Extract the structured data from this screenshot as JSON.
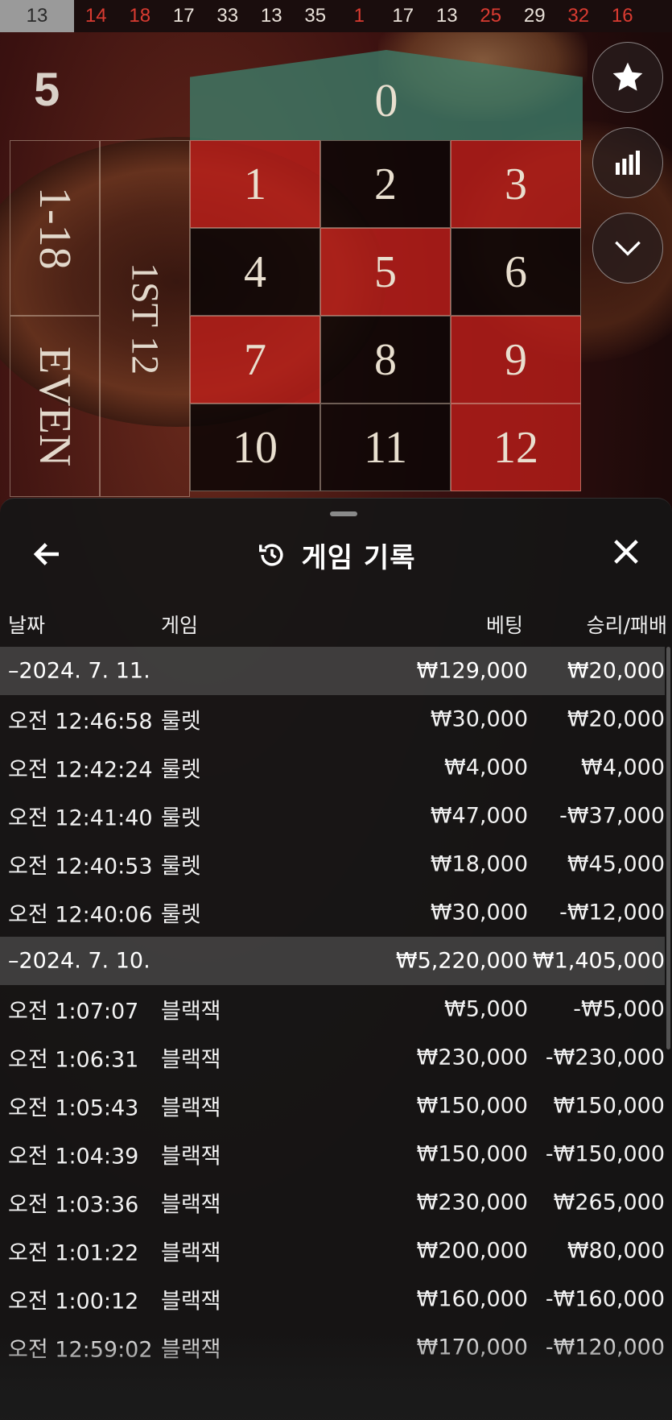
{
  "history_strip": [
    {
      "n": "13",
      "color": "gray"
    },
    {
      "n": "14",
      "color": "red"
    },
    {
      "n": "18",
      "color": "red"
    },
    {
      "n": "17",
      "color": "black"
    },
    {
      "n": "33",
      "color": "black"
    },
    {
      "n": "13",
      "color": "black"
    },
    {
      "n": "35",
      "color": "black"
    },
    {
      "n": "1",
      "color": "red"
    },
    {
      "n": "17",
      "color": "black"
    },
    {
      "n": "13",
      "color": "black"
    },
    {
      "n": "25",
      "color": "red"
    },
    {
      "n": "29",
      "color": "black"
    },
    {
      "n": "32",
      "color": "red"
    },
    {
      "n": "16",
      "color": "red"
    }
  ],
  "last_result": "5",
  "table": {
    "zero": "0",
    "side_low": "1-18",
    "side_even": "EVEN",
    "dozen_first": "1ST 12",
    "numbers": [
      {
        "n": "1",
        "c": "r"
      },
      {
        "n": "2",
        "c": "b"
      },
      {
        "n": "3",
        "c": "r"
      },
      {
        "n": "4",
        "c": "b"
      },
      {
        "n": "5",
        "c": "r"
      },
      {
        "n": "6",
        "c": "b"
      },
      {
        "n": "7",
        "c": "r"
      },
      {
        "n": "8",
        "c": "b"
      },
      {
        "n": "9",
        "c": "r"
      },
      {
        "n": "10",
        "c": "b"
      },
      {
        "n": "11",
        "c": "b"
      },
      {
        "n": "12",
        "c": "r"
      }
    ]
  },
  "side_buttons": [
    "star-icon",
    "stats-icon",
    "chevron-down-icon"
  ],
  "sheet": {
    "title": "게임 기록",
    "columns": {
      "date": "날짜",
      "game": "게임",
      "bet": "베팅",
      "win_loss": "승리/패배"
    },
    "sections": [
      {
        "date": "–2024. 7. 11.",
        "bet_total": "₩129,000",
        "win_total": "₩20,000",
        "rows": [
          {
            "time": "오전 12:46:58",
            "game": "룰렛",
            "bet": "₩30,000",
            "win": "₩20,000"
          },
          {
            "time": "오전 12:42:24",
            "game": "룰렛",
            "bet": "₩4,000",
            "win": "₩4,000"
          },
          {
            "time": "오전 12:41:40",
            "game": "룰렛",
            "bet": "₩47,000",
            "win": "-₩37,000"
          },
          {
            "time": "오전 12:40:53",
            "game": "룰렛",
            "bet": "₩18,000",
            "win": "₩45,000"
          },
          {
            "time": "오전 12:40:06",
            "game": "룰렛",
            "bet": "₩30,000",
            "win": "-₩12,000"
          }
        ]
      },
      {
        "date": "–2024. 7. 10.",
        "bet_total": "₩5,220,000",
        "win_total": "₩1,405,000",
        "rows": [
          {
            "time": "오전 1:07:07",
            "game": "블랙잭",
            "bet": "₩5,000",
            "win": "-₩5,000"
          },
          {
            "time": "오전 1:06:31",
            "game": "블랙잭",
            "bet": "₩230,000",
            "win": "-₩230,000"
          },
          {
            "time": "오전 1:05:43",
            "game": "블랙잭",
            "bet": "₩150,000",
            "win": "₩150,000"
          },
          {
            "time": "오전 1:04:39",
            "game": "블랙잭",
            "bet": "₩150,000",
            "win": "-₩150,000"
          },
          {
            "time": "오전 1:03:36",
            "game": "블랙잭",
            "bet": "₩230,000",
            "win": "₩265,000"
          },
          {
            "time": "오전 1:01:22",
            "game": "블랙잭",
            "bet": "₩200,000",
            "win": "₩80,000"
          },
          {
            "time": "오전 1:00:12",
            "game": "블랙잭",
            "bet": "₩160,000",
            "win": "-₩160,000"
          },
          {
            "time": "오전 12:59:02",
            "game": "블랙잭",
            "bet": "₩170,000",
            "win": "-₩120,000"
          }
        ]
      }
    ]
  },
  "colors": {
    "red": "#d93b31",
    "sheet_bg": "#161616",
    "section_bg": "#5a5a5a"
  }
}
